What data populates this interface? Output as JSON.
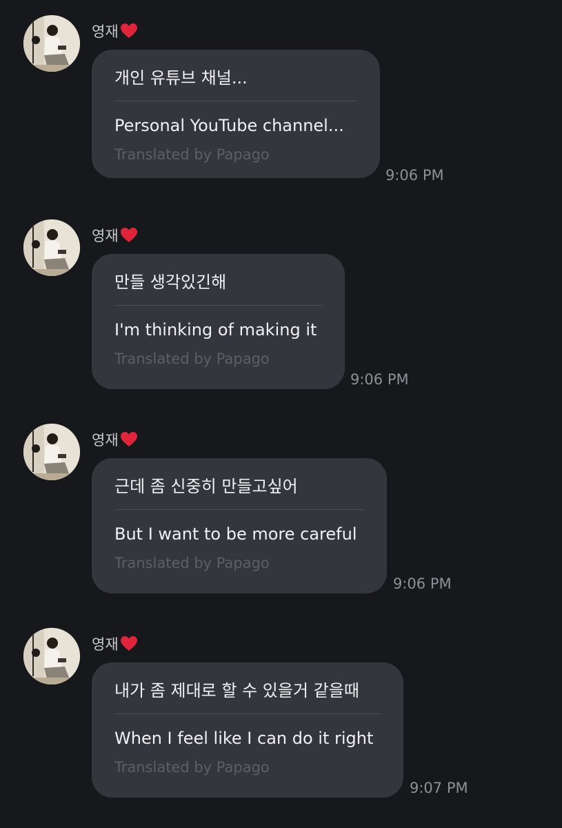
{
  "messages": [
    {
      "sender": "영재",
      "original": "개인 유튜브 채널...",
      "translation": "Personal YouTube channel...",
      "credit": "Translated by Papago",
      "time": "9:06 PM"
    },
    {
      "sender": "영재",
      "original": "만들 생각있긴해",
      "translation": "I'm thinking of making it",
      "credit": "Translated by Papago",
      "time": "9:06 PM"
    },
    {
      "sender": "영재",
      "original": "근데 좀 신중히 만들고싶어",
      "translation": "But I want to be more careful",
      "credit": "Translated by Papago",
      "time": "9:06 PM"
    },
    {
      "sender": "영재",
      "original": "내가 좀 제대로 할 수 있을거 같을때",
      "translation": "When I feel like I can do it right",
      "credit": "Translated by Papago",
      "time": "9:07 PM"
    }
  ],
  "icons": {
    "sender_badge": "red-heart-icon",
    "avatar": "profile-photo"
  },
  "colors": {
    "background": "#17181c",
    "bubble": "#34363d",
    "heart": "#e0243a"
  }
}
